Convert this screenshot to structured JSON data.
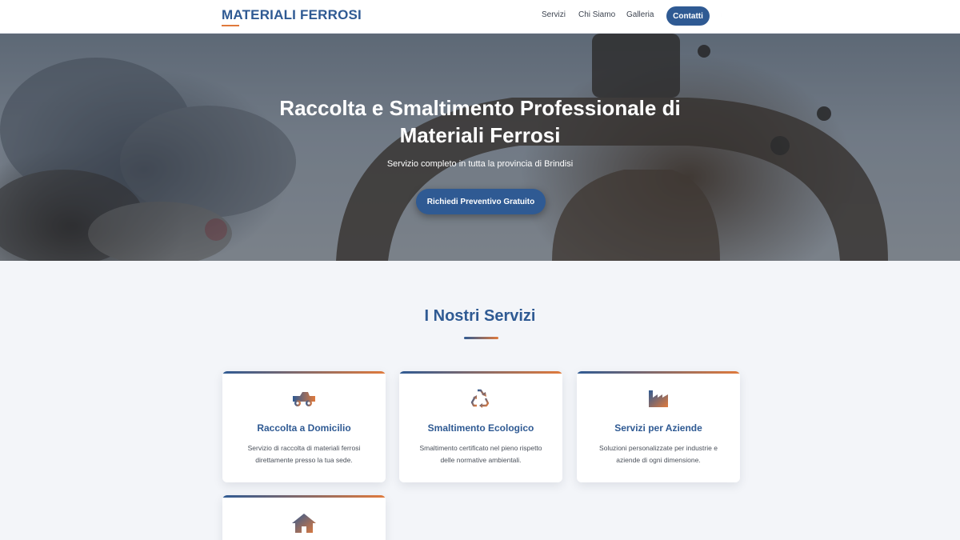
{
  "navbar": {
    "brand": "MATERIALI FERROSI",
    "links": [
      "Servizi",
      "Chi Siamo",
      "Galleria"
    ],
    "contact_label": "Contatti",
    "theme_toggle_icon": "moon-icon"
  },
  "hero": {
    "title": "Raccolta e Smaltimento Professionale di Materiali Ferrosi",
    "subtitle": "Servizio completo in tutta la provincia di Brindisi",
    "cta_label": "Richiedi Preventivo Gratuito"
  },
  "services": {
    "title": "I Nostri Servizi",
    "cards": [
      {
        "icon": "truck-icon",
        "title": "Raccolta a Domicilio",
        "description": "Servizio di raccolta di materiali ferrosi direttamente presso la tua sede."
      },
      {
        "icon": "recycle-icon",
        "title": "Smaltimento Ecologico",
        "description": "Smaltimento certificato nel pieno rispetto delle normative ambientali."
      },
      {
        "icon": "factory-icon",
        "title": "Servizi per Aziende",
        "description": "Soluzioni personalizzate per industrie e aziende di ogni dimensione."
      },
      {
        "icon": "home-icon",
        "title": "",
        "description": ""
      }
    ]
  },
  "colors": {
    "primary": "#2f5a93",
    "accent": "#e07a3c",
    "background": "#f3f5f9"
  }
}
